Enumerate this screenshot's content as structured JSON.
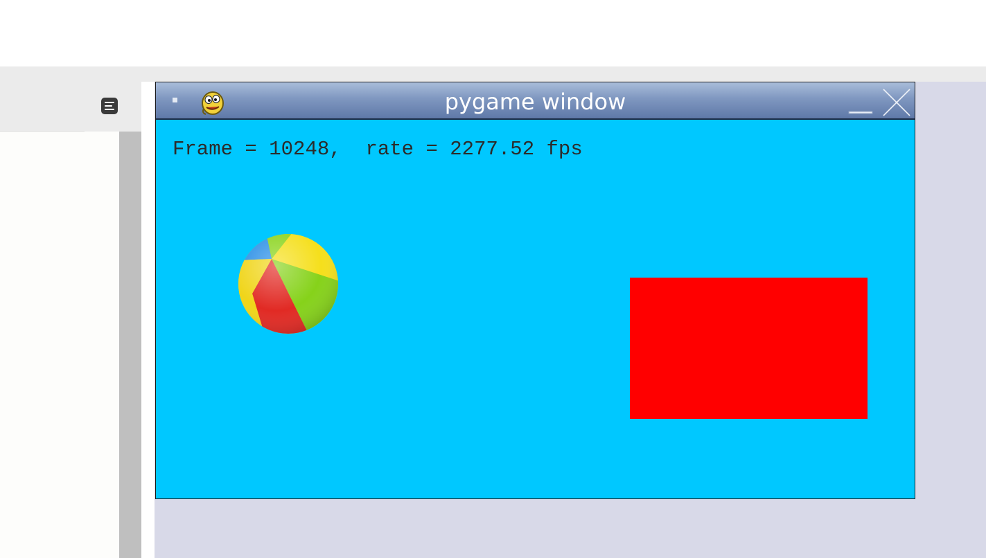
{
  "window": {
    "title": "pygame window"
  },
  "game": {
    "frame_label": "Frame = ",
    "frame_value": "10248",
    "rate_label": ",  rate = ",
    "rate_value": "2277.52",
    "rate_unit": " fps",
    "background_color": "#00c8ff",
    "rect_color": "#ff0000"
  },
  "icons": {
    "window_menu": "window-menu-icon",
    "app": "pygame-snake-icon",
    "minimize": "minimize-icon",
    "close": "close-icon",
    "outline": "outline-list-icon"
  },
  "colors": {
    "title_bar": "#7f97c0",
    "desktop": "#d8d9e8",
    "left_panel": "#ebebeb",
    "scrollbar": "#bfbfbf"
  }
}
